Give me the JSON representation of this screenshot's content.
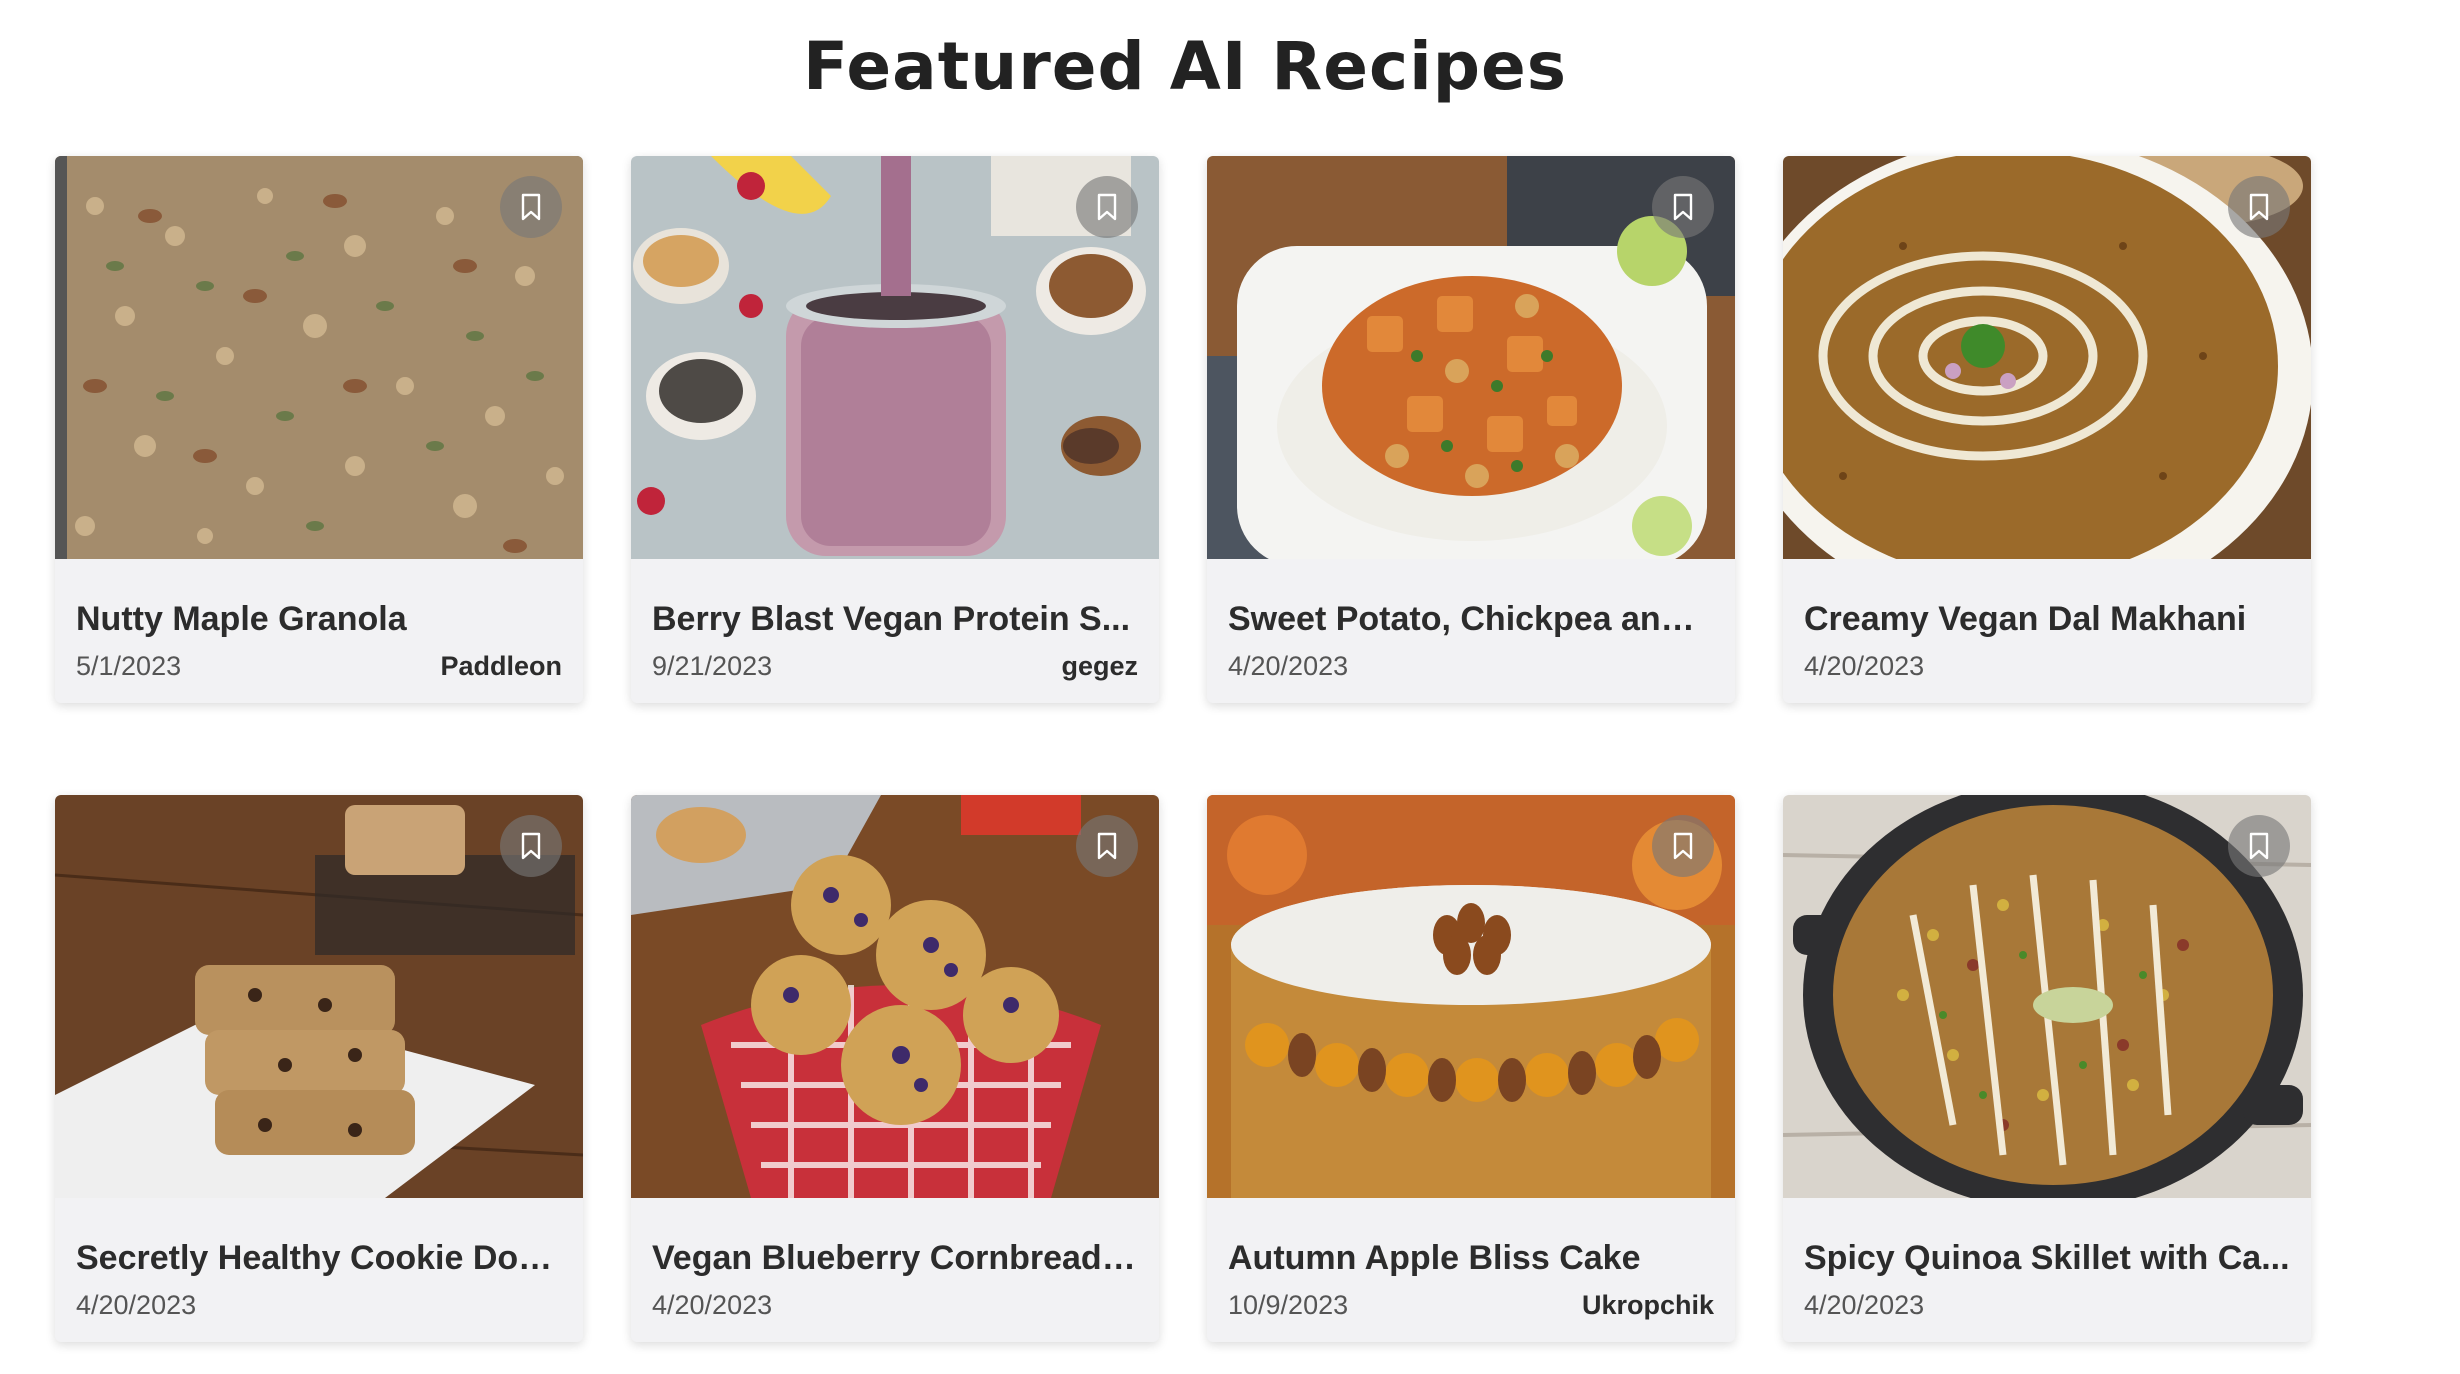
{
  "page": {
    "title": "Featured AI Recipes"
  },
  "recipes": [
    {
      "name": "Nutty Maple Granola",
      "date": "5/1/2023",
      "author": "Paddleon",
      "image": "granola-tray"
    },
    {
      "name": "Berry Blast Vegan Protein S...",
      "date": "9/21/2023",
      "author": "gegez",
      "image": "berry-smoothie-jar"
    },
    {
      "name": "Sweet Potato, Chickpea and ...",
      "date": "4/20/2023",
      "author": "",
      "image": "chickpea-curry-plate"
    },
    {
      "name": "Creamy Vegan Dal Makhani",
      "date": "4/20/2023",
      "author": "",
      "image": "dal-makhani-bowl"
    },
    {
      "name": "Secretly Healthy Cookie Dou...",
      "date": "4/20/2023",
      "author": "",
      "image": "cookie-dough-bars"
    },
    {
      "name": "Vegan Blueberry Cornbread ...",
      "date": "4/20/2023",
      "author": "",
      "image": "blueberry-muffins-basket"
    },
    {
      "name": "Autumn Apple Bliss Cake",
      "date": "10/9/2023",
      "author": "Ukropchik",
      "image": "apple-cake"
    },
    {
      "name": "Spicy Quinoa Skillet with Ca...",
      "date": "4/20/2023",
      "author": "",
      "image": "quinoa-skillet"
    }
  ],
  "icons": {
    "save": "bookmark-icon"
  },
  "colors": {
    "card_bg": "#f2f2f4",
    "bookmark_bg": "#787878",
    "text": "#2c2c2c"
  }
}
